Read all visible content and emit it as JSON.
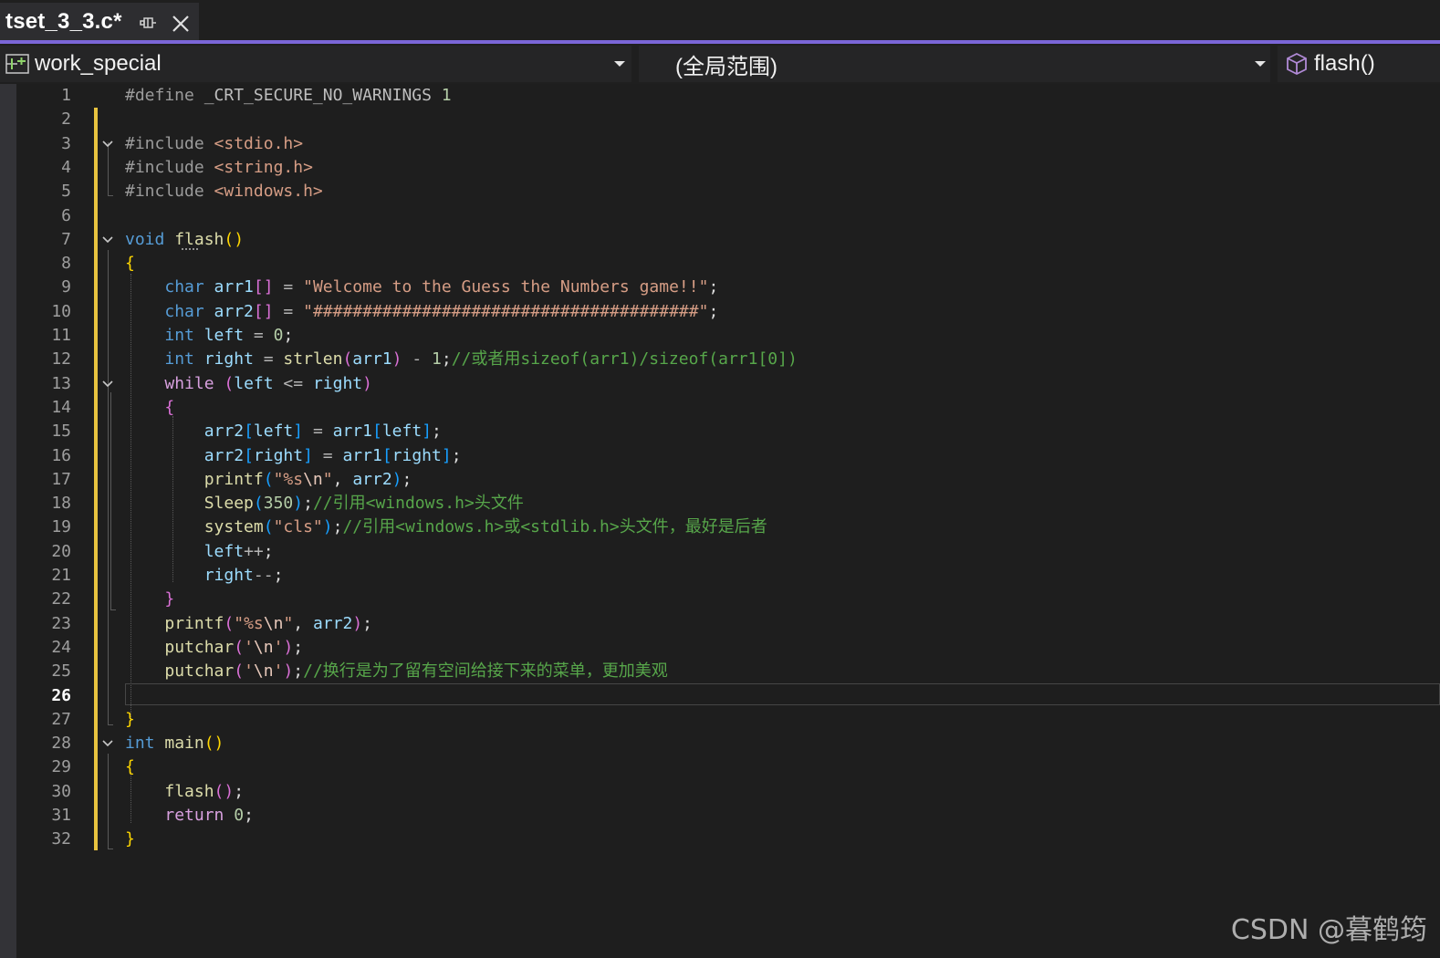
{
  "tab": {
    "filename": "tset_3_3.c*"
  },
  "navbar": {
    "project": "work_special",
    "scope": "(全局范围)",
    "member": "flash()"
  },
  "editor": {
    "current_line": 26,
    "lines": [
      [
        [
          "pp",
          "#define "
        ],
        [
          "mac",
          "_CRT_SECURE_NO_WARNINGS"
        ],
        [
          "num",
          " 1"
        ]
      ],
      [],
      [
        [
          "pp",
          "#include "
        ],
        [
          "str",
          "<stdio.h>"
        ]
      ],
      [
        [
          "pp",
          "#include "
        ],
        [
          "str",
          "<string.h>"
        ]
      ],
      [
        [
          "pp",
          "#include "
        ],
        [
          "str",
          "<windows.h>"
        ]
      ],
      [],
      [
        [
          "kw",
          "void "
        ],
        [
          "fn",
          "flash"
        ],
        [
          "p1",
          "()"
        ]
      ],
      [
        [
          "p1",
          "{"
        ]
      ],
      [
        [
          "",
          "    "
        ],
        [
          "kw",
          "char "
        ],
        [
          "var",
          "arr1"
        ],
        [
          "p2",
          "[]"
        ],
        [
          "op",
          " = "
        ],
        [
          "str",
          "\"Welcome to the Guess the Numbers game!!\""
        ],
        [
          "",
          ";"
        ]
      ],
      [
        [
          "",
          "    "
        ],
        [
          "kw",
          "char "
        ],
        [
          "var",
          "arr2"
        ],
        [
          "p2",
          "[]"
        ],
        [
          "op",
          " = "
        ],
        [
          "str",
          "\"#######################################\""
        ],
        [
          "",
          ";"
        ]
      ],
      [
        [
          "",
          "    "
        ],
        [
          "kw",
          "int "
        ],
        [
          "var",
          "left"
        ],
        [
          "op",
          " = "
        ],
        [
          "num",
          "0"
        ],
        [
          "",
          ";"
        ]
      ],
      [
        [
          "",
          "    "
        ],
        [
          "kw",
          "int "
        ],
        [
          "var",
          "right"
        ],
        [
          "op",
          " = "
        ],
        [
          "fn",
          "strlen"
        ],
        [
          "p2",
          "("
        ],
        [
          "var",
          "arr1"
        ],
        [
          "p2",
          ")"
        ],
        [
          "op",
          " - "
        ],
        [
          "num",
          "1"
        ],
        [
          "",
          ";"
        ],
        [
          "cmt",
          "//或者用sizeof(arr1)/sizeof(arr1[0])"
        ]
      ],
      [
        [
          "",
          "    "
        ],
        [
          "ctl",
          "while "
        ],
        [
          "p2",
          "("
        ],
        [
          "var",
          "left"
        ],
        [
          "op",
          " <= "
        ],
        [
          "var",
          "right"
        ],
        [
          "p2",
          ")"
        ]
      ],
      [
        [
          "",
          "    "
        ],
        [
          "p2",
          "{"
        ]
      ],
      [
        [
          "",
          "        "
        ],
        [
          "var",
          "arr2"
        ],
        [
          "p3",
          "["
        ],
        [
          "var",
          "left"
        ],
        [
          "p3",
          "]"
        ],
        [
          "op",
          " = "
        ],
        [
          "var",
          "arr1"
        ],
        [
          "p3",
          "["
        ],
        [
          "var",
          "left"
        ],
        [
          "p3",
          "]"
        ],
        [
          "",
          ";"
        ]
      ],
      [
        [
          "",
          "        "
        ],
        [
          "var",
          "arr2"
        ],
        [
          "p3",
          "["
        ],
        [
          "var",
          "right"
        ],
        [
          "p3",
          "]"
        ],
        [
          "op",
          " = "
        ],
        [
          "var",
          "arr1"
        ],
        [
          "p3",
          "["
        ],
        [
          "var",
          "right"
        ],
        [
          "p3",
          "]"
        ],
        [
          "",
          ";"
        ]
      ],
      [
        [
          "",
          "        "
        ],
        [
          "fn",
          "printf"
        ],
        [
          "p3",
          "("
        ],
        [
          "str",
          "\"%s"
        ],
        [
          "esc",
          "\\n"
        ],
        [
          "str",
          "\""
        ],
        [
          "",
          ", "
        ],
        [
          "var",
          "arr2"
        ],
        [
          "p3",
          ")"
        ],
        [
          "",
          ";"
        ]
      ],
      [
        [
          "",
          "        "
        ],
        [
          "fn",
          "Sleep"
        ],
        [
          "p3",
          "("
        ],
        [
          "num",
          "350"
        ],
        [
          "p3",
          ")"
        ],
        [
          "",
          ";"
        ],
        [
          "cmt",
          "//引用<windows.h>头文件"
        ]
      ],
      [
        [
          "",
          "        "
        ],
        [
          "fn",
          "system"
        ],
        [
          "p3",
          "("
        ],
        [
          "str",
          "\"cls\""
        ],
        [
          "p3",
          ")"
        ],
        [
          "",
          ";"
        ],
        [
          "cmt",
          "//引用<windows.h>或<stdlib.h>头文件，最好是后者"
        ]
      ],
      [
        [
          "",
          "        "
        ],
        [
          "var",
          "left"
        ],
        [
          "op",
          "++"
        ],
        [
          "",
          ";"
        ]
      ],
      [
        [
          "",
          "        "
        ],
        [
          "var",
          "right"
        ],
        [
          "op",
          "--"
        ],
        [
          "",
          ";"
        ]
      ],
      [
        [
          "",
          "    "
        ],
        [
          "p2",
          "}"
        ]
      ],
      [
        [
          "",
          "    "
        ],
        [
          "fn",
          "printf"
        ],
        [
          "p2",
          "("
        ],
        [
          "str",
          "\"%s"
        ],
        [
          "esc",
          "\\n"
        ],
        [
          "str",
          "\""
        ],
        [
          "",
          ", "
        ],
        [
          "var",
          "arr2"
        ],
        [
          "p2",
          ")"
        ],
        [
          "",
          ";"
        ]
      ],
      [
        [
          "",
          "    "
        ],
        [
          "fn",
          "putchar"
        ],
        [
          "p2",
          "("
        ],
        [
          "str",
          "'"
        ],
        [
          "esc",
          "\\n"
        ],
        [
          "str",
          "'"
        ],
        [
          "p2",
          ")"
        ],
        [
          "",
          ";"
        ]
      ],
      [
        [
          "",
          "    "
        ],
        [
          "fn",
          "putchar"
        ],
        [
          "p2",
          "("
        ],
        [
          "str",
          "'"
        ],
        [
          "esc",
          "\\n"
        ],
        [
          "str",
          "'"
        ],
        [
          "p2",
          ")"
        ],
        [
          "",
          ";"
        ],
        [
          "cmt",
          "//换行是为了留有空间给接下来的菜单，更加美观"
        ]
      ],
      [],
      [
        [
          "p1",
          "}"
        ]
      ],
      [
        [
          "kw",
          "int "
        ],
        [
          "fn",
          "main"
        ],
        [
          "p1",
          "()"
        ]
      ],
      [
        [
          "p1",
          "{"
        ]
      ],
      [
        [
          "",
          "    "
        ],
        [
          "fn",
          "flash"
        ],
        [
          "p2",
          "()"
        ],
        [
          "",
          ";"
        ]
      ],
      [
        [
          "",
          "    "
        ],
        [
          "ctl",
          "return "
        ],
        [
          "num",
          "0"
        ],
        [
          "",
          ";"
        ]
      ],
      [
        [
          "p1",
          "}"
        ]
      ]
    ]
  },
  "watermark": "CSDN @暮鹤筠"
}
